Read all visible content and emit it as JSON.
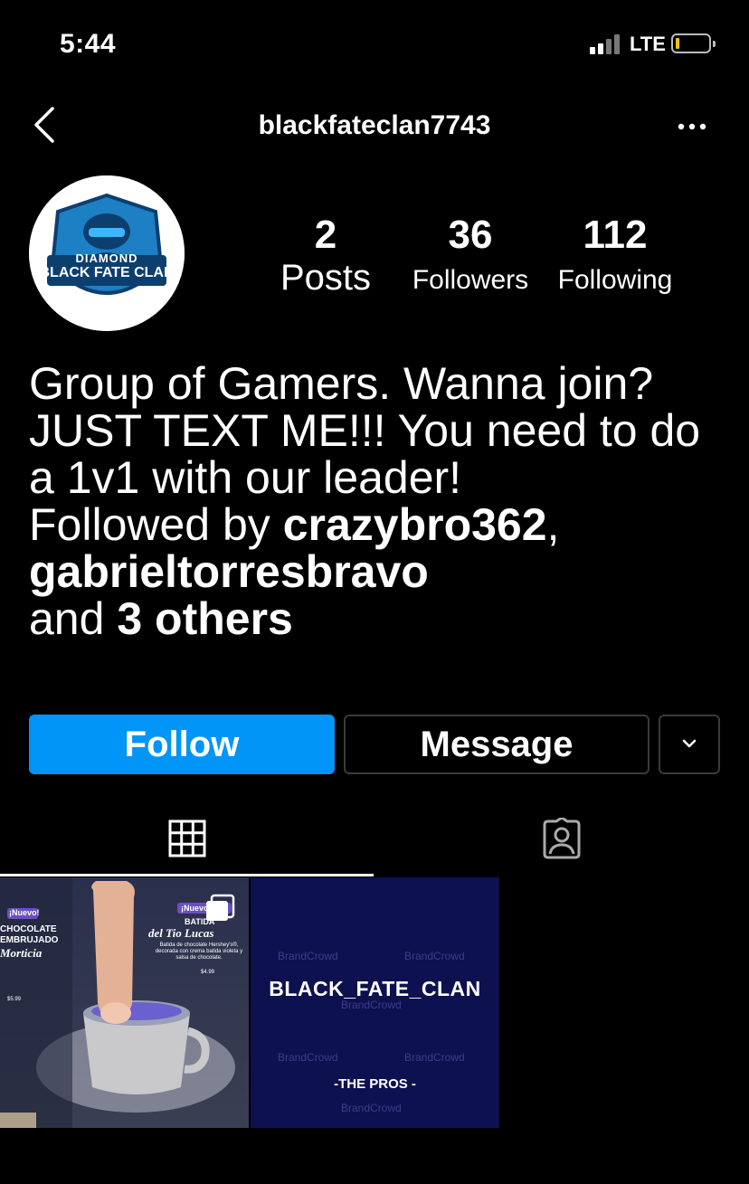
{
  "status_bar": {
    "time": "5:44",
    "network": "LTE"
  },
  "header": {
    "username": "blackfateclan7743"
  },
  "avatar": {
    "line1": "DIAMOND",
    "line2": "BLACK FATE CLAN"
  },
  "stats": {
    "posts": {
      "count": "2",
      "label": "Posts"
    },
    "followers": {
      "count": "36",
      "label": "Followers"
    },
    "following": {
      "count": "112",
      "label": "Following"
    }
  },
  "bio": {
    "text": "Group of Gamers. Wanna join? JUST TEXT ME!!! You need to do a 1v1 with our leader!",
    "followed_prefix": "Followed by ",
    "follower1": "crazybro362",
    "follower2": "gabrieltorresbravo",
    "and": "and ",
    "others": "3 others"
  },
  "actions": {
    "follow": "Follow",
    "message": "Message"
  },
  "colors": {
    "follow_button": "#0095f6",
    "background": "#000000",
    "battery": "#f5c400"
  },
  "posts": [
    {
      "badge1": "¡Nuevo!",
      "heading1a": "CHOCOLATE",
      "heading1b": "EMBRUJADO",
      "script1": "Morticia",
      "badge2": "¡Nuevo!",
      "heading2a": "BATIDA",
      "script2": "del Tio Lucas",
      "desc2": "Batida de chocolate Hershey's®, decorada con crema batida violeta y salsa de chocolate.",
      "price2": "$4.99",
      "price1": "$5.99"
    },
    {
      "title": "BLACK_FATE_CLAN",
      "subtitle": "-THE PROS -",
      "watermark": "BrandCrowd"
    }
  ]
}
